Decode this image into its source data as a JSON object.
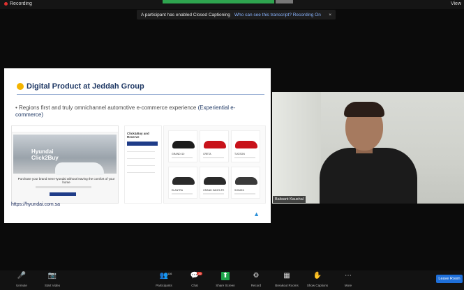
{
  "topbar": {
    "recording_label": "Recording",
    "view_label": "View"
  },
  "notice": {
    "text": "A participant has enabled Closed Captioning",
    "link": "Who can see this transcript? Recording On",
    "close": "×"
  },
  "slide": {
    "title": "Digital Product at Jeddah Group",
    "bullet_main": "Regions first and truly omnichannel automotive e-commerce experience",
    "bullet_highlight": "(Experiential e-commerce)",
    "panel1": {
      "hero_text_line1": "Hyundai",
      "hero_text_line2": "Click2Buy",
      "caption": "Purchase your brand new Hyundai without leaving the comfort of your home"
    },
    "panel2": {
      "title": "Click&Buy and Reserve"
    },
    "cars": [
      {
        "label": "GRAND i10",
        "color": "#1c1c1c"
      },
      {
        "label": "CRETA",
        "color": "#c8121a"
      },
      {
        "label": "TUCSON",
        "color": "#c8121a"
      },
      {
        "label": "ELANTRA",
        "color": "#2a2a2a"
      },
      {
        "label": "GRAND SANTA FE",
        "color": "#2a2a2a"
      },
      {
        "label": "SONATA",
        "color": "#3a3a3a"
      }
    ],
    "url": "https://hyundai.com.sa",
    "logo": "▲"
  },
  "video": {
    "name": "Balwant Kaushal"
  },
  "toolbar": {
    "items": [
      {
        "icon": "🎤",
        "label": "Unmute"
      },
      {
        "icon": "📷",
        "label": "Start Video"
      },
      {
        "icon": "👥",
        "label": "Participants"
      },
      {
        "icon": "💬",
        "label": "Chat"
      },
      {
        "icon": "⬆",
        "label": "Share Screen"
      },
      {
        "icon": "⚙",
        "label": "Record"
      },
      {
        "icon": "▦",
        "label": "Breakout Rooms"
      },
      {
        "icon": "✋",
        "label": "Show Captions"
      },
      {
        "icon": "⋯",
        "label": "More"
      }
    ],
    "participants_count": "116",
    "chat_badge": "39",
    "leave_label": "Leave Room"
  }
}
